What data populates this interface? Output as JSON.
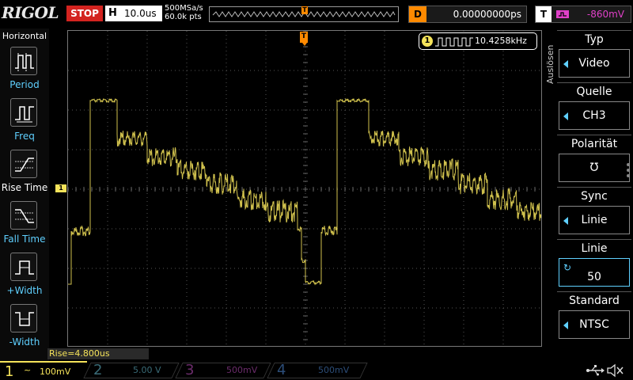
{
  "top": {
    "logo": "RIGOL",
    "run_state": "STOP",
    "h_label": "H",
    "h_value": "10.0us",
    "sample_rate": "500MSa/s",
    "memory_depth": "60.0k pts",
    "d_label": "D",
    "delay_value": "0.00000000ps",
    "t_label": "T",
    "trigger_level": "-860mV"
  },
  "left": {
    "title": "Horizontal",
    "items": [
      {
        "label": "Period"
      },
      {
        "label": "Freq"
      },
      {
        "label": "Rise Time"
      },
      {
        "label": "Fall Time"
      },
      {
        "label": "+Width"
      },
      {
        "label": "-Width"
      }
    ]
  },
  "measure": {
    "channel": "1",
    "freq": "10.4258kHz",
    "rise": "Rise=4.800us",
    "trig_marker": "T",
    "ch1_marker": "1"
  },
  "right": {
    "vertical_title": "Auslösen",
    "items": [
      {
        "header": "Typ",
        "value": "Video"
      },
      {
        "header": "Quelle",
        "value": "CH3"
      },
      {
        "header": "Polarität",
        "value": "Ʊ"
      },
      {
        "header": "Sync",
        "value": "Linie"
      },
      {
        "header": "Linie",
        "value": "50"
      },
      {
        "header": "Standard",
        "value": "NTSC"
      }
    ]
  },
  "bottom": {
    "channels": [
      {
        "num": "1",
        "sym": "~",
        "value": "100mV",
        "color": "#f5e35a"
      },
      {
        "num": "2",
        "value": "5.00 V",
        "color": "#3a6b77"
      },
      {
        "num": "3",
        "value": "500mV",
        "color": "#6b2c6b"
      },
      {
        "num": "4",
        "value": "500mV",
        "color": "#2c4d78"
      }
    ]
  },
  "colors": {
    "ch1": "#f5e35a",
    "trigger": "#ff8a00",
    "accent": "#5fd0ff",
    "stop": "#d3231f"
  },
  "icons": [
    "period-icon",
    "freq-icon",
    "rise-time-icon",
    "fall-time-icon",
    "pos-width-icon",
    "neg-width-icon",
    "usb-icon",
    "mute-icon"
  ]
}
